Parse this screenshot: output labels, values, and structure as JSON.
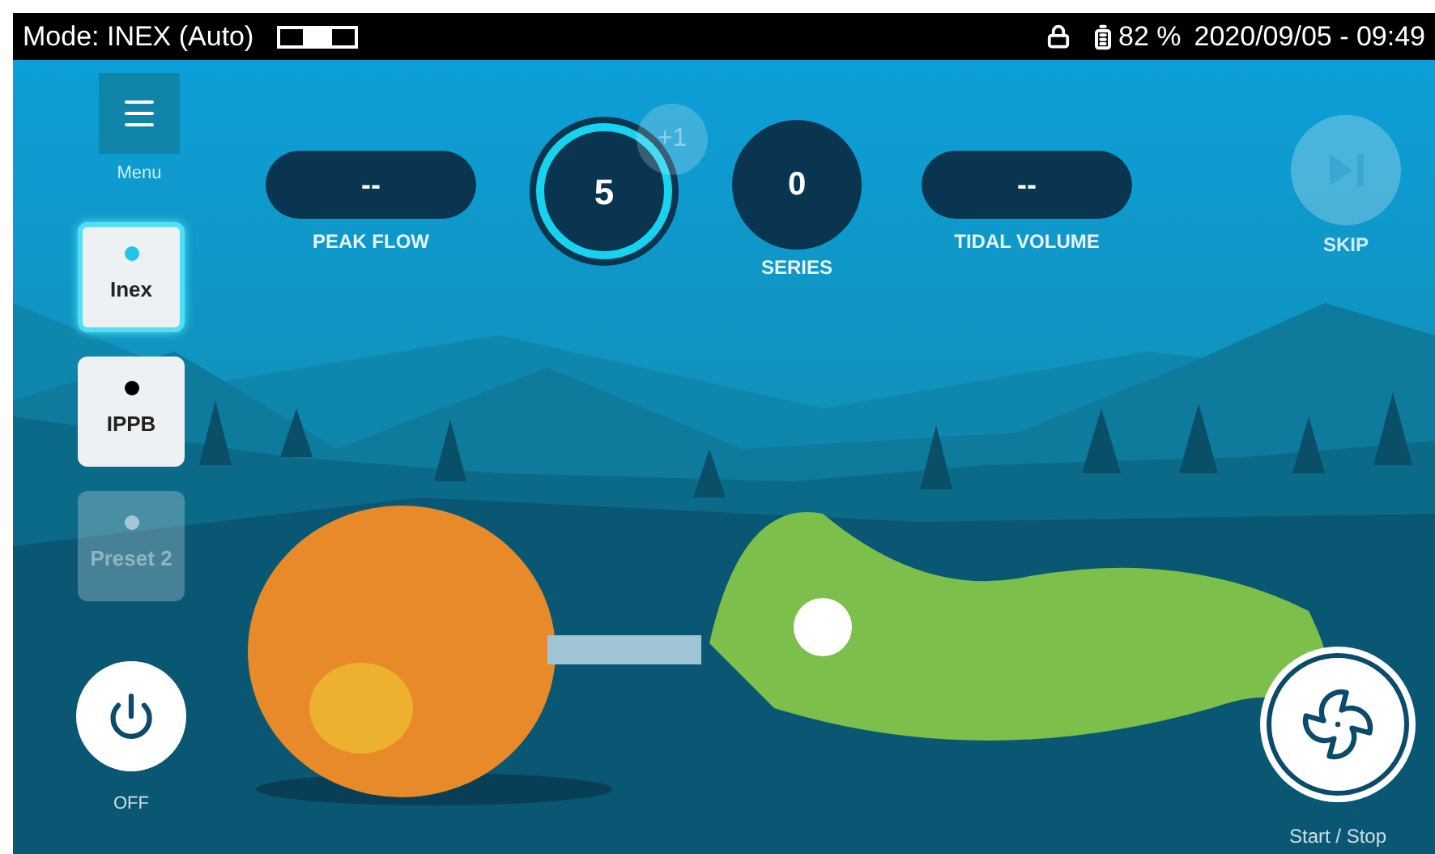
{
  "status_bar": {
    "mode": "Mode: INEX (Auto)",
    "battery": "82 %",
    "datetime": "2020/09/05 - 09:49"
  },
  "menu": {
    "label": "Menu"
  },
  "modes": [
    {
      "label": "Inex",
      "selected": true,
      "disabled": false
    },
    {
      "label": "IPPB",
      "selected": false,
      "disabled": false
    },
    {
      "label": "Preset 2",
      "selected": false,
      "disabled": true
    }
  ],
  "metrics": [
    {
      "kind": "pill",
      "value": "--",
      "label": "PEAK FLOW"
    },
    {
      "kind": "counter",
      "value": "5",
      "badge": "+1"
    },
    {
      "kind": "circle",
      "value": "0",
      "label": "SERIES"
    },
    {
      "kind": "pill",
      "value": "--",
      "label": "TIDAL VOLUME"
    }
  ],
  "skip": {
    "label": "SKIP",
    "disabled": true
  },
  "power": {
    "label": "OFF"
  },
  "start_stop": {
    "label": "Start / Stop"
  }
}
